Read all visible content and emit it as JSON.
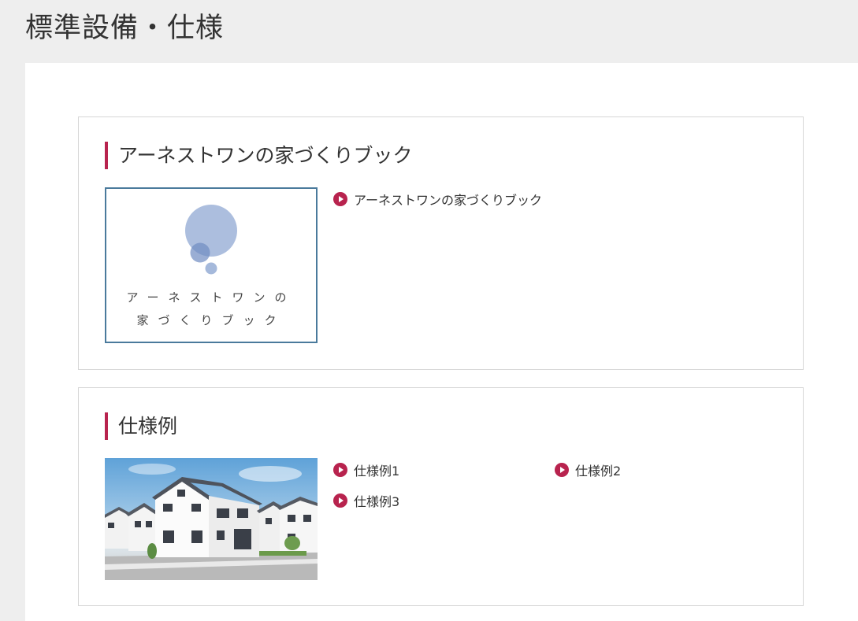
{
  "page": {
    "title": "標準設備・仕様"
  },
  "colors": {
    "accent": "#b8234e",
    "book_border": "#4a7a9c",
    "book_bubble": "#7f9bcc"
  },
  "sections": [
    {
      "heading": "アーネストワンの家づくりブック",
      "thumbnail": {
        "line1": "アーネストワンの",
        "line2": "家づくりブック"
      },
      "links": [
        {
          "label": "アーネストワンの家づくりブック",
          "icon": "play-circle-icon"
        }
      ]
    },
    {
      "heading": "仕様例",
      "thumbnail": {
        "alt": "house-photo"
      },
      "links": [
        {
          "label": "仕様例1",
          "icon": "play-circle-icon"
        },
        {
          "label": "仕様例2",
          "icon": "play-circle-icon"
        },
        {
          "label": "仕様例3",
          "icon": "play-circle-icon"
        }
      ]
    }
  ]
}
